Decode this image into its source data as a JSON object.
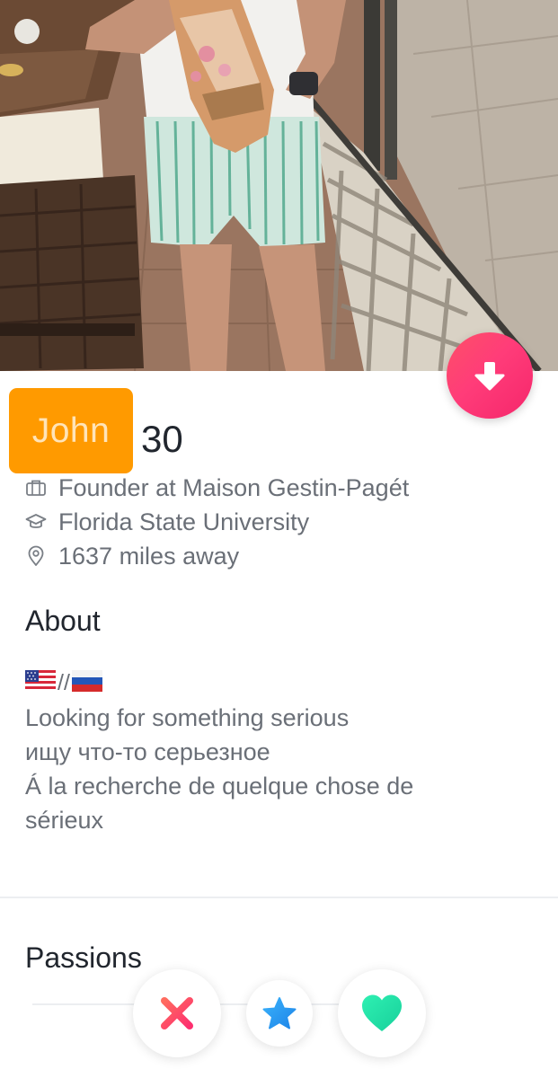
{
  "profile": {
    "name": "John",
    "age": "30",
    "job": "Founder at Maison Gestin-Pagét",
    "school": "Florida State University",
    "distance": "1637 miles away"
  },
  "about": {
    "title": "About",
    "flag_separator": "//",
    "bio_lines": [
      "Looking for something serious",
      "ищу что-то серьезное",
      "Á la recherche de quelque chose de",
      "sérieux"
    ]
  },
  "passions": {
    "title": "Passions"
  },
  "icons": {
    "collapse": "arrow-down-icon",
    "job": "briefcase-icon",
    "school": "graduation-cap-icon",
    "location": "location-pin-icon",
    "flag_us": "us-flag-icon",
    "flag_ru": "russia-flag-icon",
    "nope": "close-x-icon",
    "super_like": "star-icon",
    "like": "heart-icon"
  },
  "colors": {
    "name_box": "#ff9a00",
    "collapse_gradient_start": "#fd5068",
    "collapse_gradient_end": "#f5266b",
    "nope": "#fd4c67",
    "super_like": "#2b9cf2",
    "like": "#1fe0a5"
  }
}
